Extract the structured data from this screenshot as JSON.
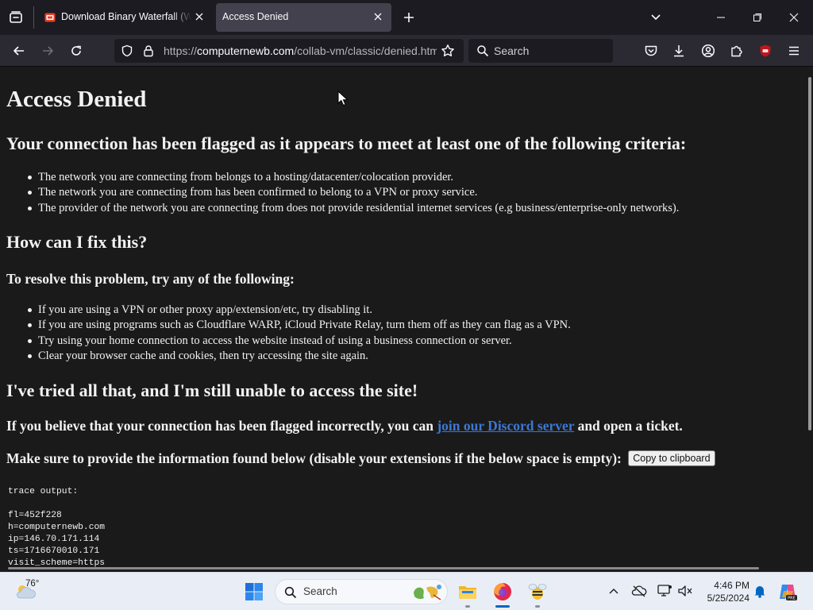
{
  "browser": {
    "tabs": [
      {
        "title": "Download Binary Waterfall (Win",
        "active": false
      },
      {
        "title": "Access Denied",
        "active": true
      }
    ],
    "url": {
      "scheme": "https://",
      "host": "computernewb.com",
      "path": "/collab-vm/classic/denied.html"
    },
    "search_placeholder": "Search",
    "accent_colors": {
      "tab_active": "#42414d",
      "toolbar": "#2b2a33",
      "ublock": "#c0151b"
    }
  },
  "page": {
    "title": "Access Denied",
    "flagged_heading": "Your connection has been flagged as it appears to meet at least one of the following criteria:",
    "criteria": [
      "The network you are connecting from belongs to a hosting/datacenter/colocation provider.",
      "The network you are connecting from has been confirmed to belong to a VPN or proxy service.",
      "The provider of the network you are connecting from does not provide residential internet services (e.g business/enterprise-only networks)."
    ],
    "fix_heading": "How can I fix this?",
    "resolve_heading": "To resolve this problem, try any of the following:",
    "fixes": [
      "If you are using a VPN or other proxy app/extension/etc, try disabling it.",
      "If you are using programs such as Cloudflare WARP, iCloud Private Relay, turn them off as they can flag as a VPN.",
      "Try using your home connection to access the website instead of using a business connection or server.",
      "Clear your browser cache and cookies, then try accessing the site again."
    ],
    "still_heading": "I've tried all that, and I'm still unable to access the site!",
    "discord_before": "If you believe that your connection has been flagged incorrectly, you can ",
    "discord_link": "join our Discord server",
    "discord_after": " and open a ticket.",
    "provide_info": "Make sure to provide the information found below (disable your extensions if the below space is empty):",
    "copy_button": "Copy to clipboard",
    "trace": {
      "label": "trace output:",
      "lines": [
        "fl=452f228",
        "h=computernewb.com",
        "ip=146.70.171.114",
        "ts=1716670010.171",
        "visit_scheme=https"
      ]
    },
    "link_color": "#3a78d6"
  },
  "taskbar": {
    "weather_temp": "76°",
    "search_placeholder": "Search",
    "time": "4:46 PM",
    "date": "5/25/2024"
  }
}
